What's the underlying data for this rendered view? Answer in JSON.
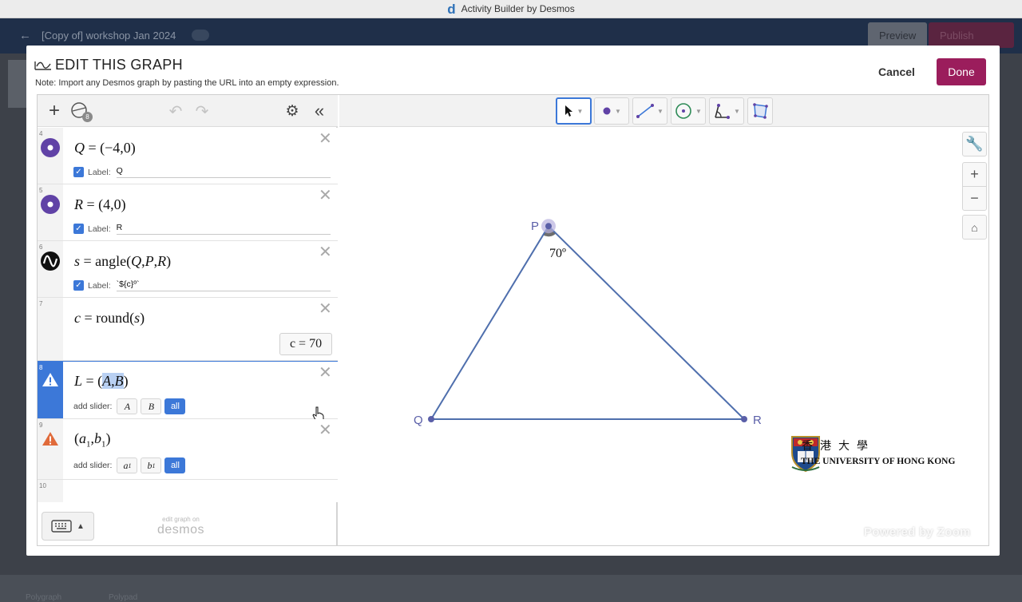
{
  "window": {
    "title": "Activity Builder by Desmos"
  },
  "background": {
    "activity_title": "[Copy of] workshop Jan 2024",
    "preview_label": "Preview",
    "publish_label": "Publish",
    "bottom_left": "Polygraph",
    "bottom_mid": "Polypad"
  },
  "modal": {
    "title": "EDIT THIS GRAPH",
    "note": "Note: Import any Desmos graph by pasting the URL into an empty expression.",
    "cancel_label": "Cancel",
    "done_label": "Done"
  },
  "header": {
    "badge_count": "8"
  },
  "expressions": [
    {
      "num": "4",
      "label_prefix": "Label:",
      "label_value": "Q"
    },
    {
      "num": "5",
      "label_prefix": "Label:",
      "label_value": "R"
    },
    {
      "num": "6",
      "label_prefix": "Label:",
      "label_value": "`${c}º`"
    },
    {
      "num": "7",
      "eval": "c  =  70"
    },
    {
      "num": "8",
      "slider_prefix": "add slider:",
      "sliders": [
        "A",
        "B",
        "all"
      ]
    },
    {
      "num": "9",
      "slider_prefix": "add slider:",
      "sliders": [
        "a1",
        "b1",
        "all"
      ]
    },
    {
      "num": "10"
    }
  ],
  "footer": {
    "edit_on": "edit graph on",
    "desmos": "desmos"
  },
  "graph": {
    "points": [
      {
        "name": "P",
        "x": -1,
        "y": 6
      },
      {
        "name": "Q",
        "x": -4,
        "y": 0
      },
      {
        "name": "R",
        "x": 4,
        "y": 0
      }
    ],
    "angle_label": "70º",
    "line_color": "#4f6fad",
    "point_color": "#5a5fa8"
  },
  "branding": {
    "hku_zh": "香港大學",
    "hku_en": "THE UNIVERSITY OF HONG KONG",
    "zoom": "Powered by Zoom"
  },
  "colors": {
    "accent": "#3c78d8",
    "done": "#9b1d5c",
    "point_purple": "#6042a6"
  }
}
